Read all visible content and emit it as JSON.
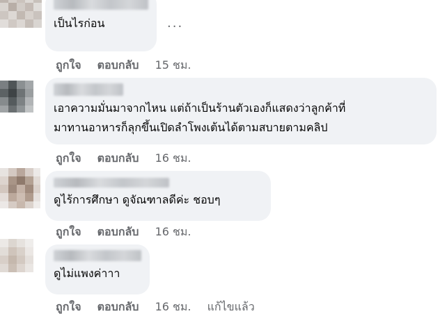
{
  "comments": [
    {
      "text_lines": [
        "เป็นไรก่อน"
      ],
      "actions": {
        "like": "ถูกใจ",
        "reply": "ตอบกลับ",
        "time": "15 ชม.",
        "edited": ""
      }
    },
    {
      "text_lines": [
        "เอาความมั่นมาจากไหน แต่ถ้าเป็นร้านตัวเองก็แสดงว่าลูกค้าที่",
        "มาทานอาหารก็ลุกขึ้นเปิดลำโพงเต้นได้ตามสบายตามคลิป"
      ],
      "actions": {
        "like": "ถูกใจ",
        "reply": "ตอบกลับ",
        "time": "16 ชม.",
        "edited": ""
      }
    },
    {
      "text_lines": [
        "ดูไร้การศึกษา ดูจัณฑาลดีค่ะ ชอบๆ"
      ],
      "actions": {
        "like": "ถูกใจ",
        "reply": "ตอบกลับ",
        "time": "16 ชม.",
        "edited": ""
      }
    },
    {
      "text_lines": [
        "ดูไม่แพงค่าาา"
      ],
      "actions": {
        "like": "ถูกใจ",
        "reply": "ตอบกลับ",
        "time": "16 ชม.",
        "edited": "แก้ไขแล้ว"
      }
    }
  ],
  "more_menu": {
    "icon": "more-horizontal-icon",
    "glyph": "···"
  },
  "colors": {
    "bubble": "#f0f2f5",
    "text": "#050505",
    "meta": "#65676b"
  }
}
